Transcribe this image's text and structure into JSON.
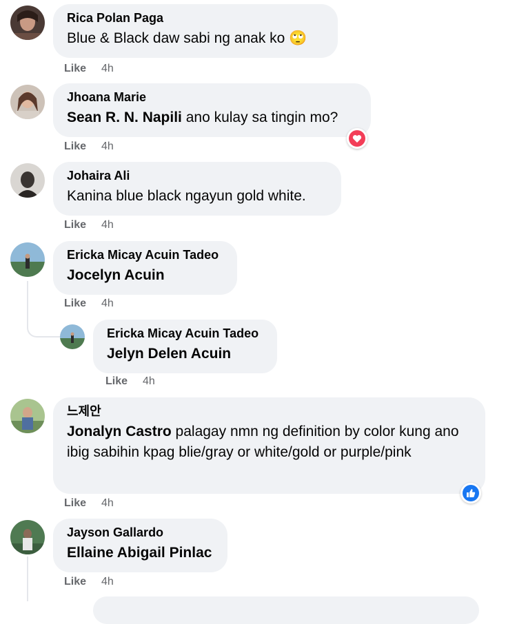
{
  "comments": [
    {
      "author": "Rica Polan Paga",
      "text": "Blue & Black daw sabi ng anak ko",
      "emoji": "🙄",
      "like": "Like",
      "time": "4h"
    },
    {
      "author": "Jhoana Marie",
      "mention": "Sean R. N. Napili",
      "text": " ano kulay sa tingin mo?",
      "reaction": "heart-icon",
      "like": "Like",
      "time": "4h"
    },
    {
      "author": "Johaira Ali",
      "text": "Kanina blue black ngayun gold white.",
      "like": "Like",
      "time": "4h"
    },
    {
      "author": "Ericka Micay Acuin Tadeo",
      "mention": "Jocelyn Acuin",
      "like": "Like",
      "time": "4h"
    },
    {
      "author": "Ericka Micay Acuin Tadeo",
      "mention": "Jelyn Delen Acuin",
      "like": "Like",
      "time": "4h"
    },
    {
      "author": "느제안",
      "mention": "Jonalyn Castro",
      "text": " palagay nmn ng definition by color kung ano ibig sabihin kpag blie/gray or white/gold or purple/pink",
      "reaction": "thumbs-up-icon",
      "like": "Like",
      "time": "4h"
    },
    {
      "author": "Jayson Gallardo",
      "mention": "Ellaine Abigail Pinlac",
      "like": "Like",
      "time": "4h"
    }
  ],
  "colors": {
    "bubble": "#f0f2f5",
    "meta": "#65676b",
    "heart": "#f33e58",
    "like_blue": "#1877f2"
  }
}
